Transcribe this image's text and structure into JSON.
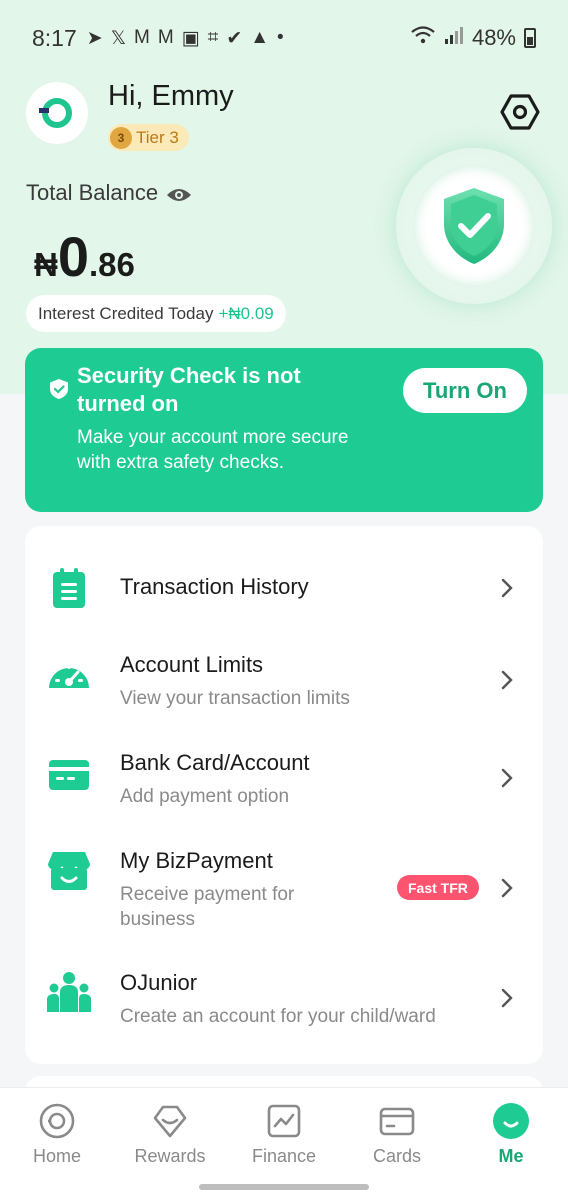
{
  "status_bar": {
    "time": "8:17",
    "battery": "48%"
  },
  "header": {
    "greeting": "Hi, Emmy",
    "tier": "Tier 3",
    "tier_medal": "3"
  },
  "balance": {
    "label": "Total Balance",
    "currency": "₦",
    "integer": "0",
    "decimal": ".86",
    "interest_label": "Interest Credited Today",
    "interest_amount": "+₦0.09"
  },
  "security": {
    "title": "Security Check is not turned on",
    "description": "Make your account more secure with extra safety checks.",
    "button": "Turn On"
  },
  "menu": {
    "items": [
      {
        "title": "Transaction History",
        "subtitle": "",
        "icon": "clipboard-icon"
      },
      {
        "title": "Account Limits",
        "subtitle": "View your transaction limits",
        "icon": "speedometer-icon"
      },
      {
        "title": "Bank Card/Account",
        "subtitle": "Add payment option",
        "icon": "card-icon"
      },
      {
        "title": "My BizPayment",
        "subtitle": "Receive payment for business",
        "icon": "store-icon",
        "badge": "Fast TFR"
      },
      {
        "title": "OJunior",
        "subtitle": "Create an account for your child/ward",
        "icon": "family-icon"
      }
    ]
  },
  "nav": {
    "items": [
      {
        "label": "Home",
        "icon": "home-icon"
      },
      {
        "label": "Rewards",
        "icon": "rewards-icon"
      },
      {
        "label": "Finance",
        "icon": "finance-icon"
      },
      {
        "label": "Cards",
        "icon": "cards-icon"
      },
      {
        "label": "Me",
        "icon": "me-icon",
        "active": true
      }
    ]
  },
  "colors": {
    "accent": "#1ecb93",
    "header_bg": "#e3f6ea",
    "badge": "#ff5470"
  }
}
